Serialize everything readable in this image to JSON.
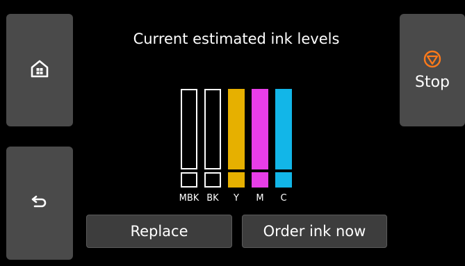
{
  "header": {
    "title": "Current estimated ink levels"
  },
  "stop": {
    "label": "Stop"
  },
  "inks": [
    {
      "label": "MBK",
      "color": "#000000",
      "level": 0
    },
    {
      "label": "BK",
      "color": "#000000",
      "level": 0
    },
    {
      "label": "Y",
      "color": "#e6b000",
      "level": 1.0
    },
    {
      "label": "M",
      "color": "#e83ee8",
      "level": 1.0
    },
    {
      "label": "C",
      "color": "#12b6e8",
      "level": 1.0
    }
  ],
  "actions": {
    "replace_label": "Replace",
    "order_label": "Order ink now"
  },
  "colors": {
    "panel_bg": "#000000",
    "button_bg": "#4a4a4a",
    "stop_accent": "#ff7a1a"
  },
  "icons": {
    "home": "home-icon",
    "back": "back-arrow-icon",
    "stop": "stop-icon"
  }
}
